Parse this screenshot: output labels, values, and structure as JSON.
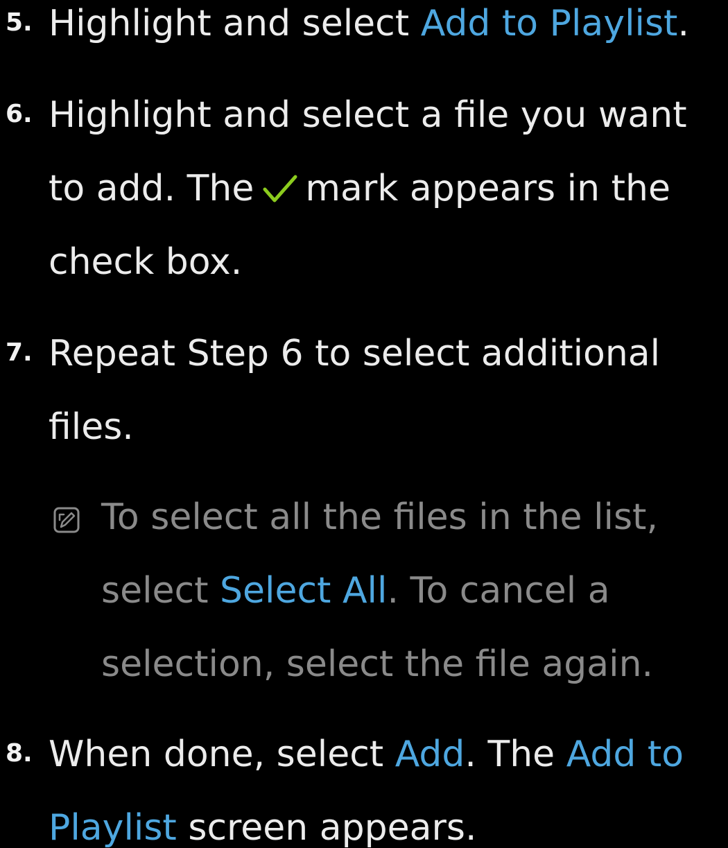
{
  "steps": [
    {
      "number": "5.",
      "line1": {
        "pre": "Highlight and select ",
        "link": "Add to Playlist",
        "post": "."
      }
    },
    {
      "number": "6.",
      "line1": "Highlight and select a file you want",
      "line2": {
        "pre": "to add. The",
        "post": "mark appears in the"
      },
      "line3": "check box."
    },
    {
      "number": "7.",
      "line1": "Repeat Step 6 to select additional",
      "line2": "files.",
      "note": {
        "line1": "To select all the files in the list,",
        "line2": {
          "pre": "select ",
          "link": "Select All",
          "post": ". To cancel a"
        },
        "line3": "selection, select the file again."
      }
    },
    {
      "number": "8.",
      "line1": {
        "pre": "When done, select ",
        "link1": "Add",
        "mid": ". The ",
        "link2": "Add to"
      },
      "line2": {
        "link": "Playlist",
        "post": " screen appears."
      }
    }
  ],
  "icons": {
    "check": "check-mark-icon",
    "note": "note-icon"
  },
  "colors": {
    "background": "#000000",
    "text": "#ececec",
    "highlight": "#4ea7e0",
    "note_text": "#8a8a8a",
    "check": "#8ccc1e"
  }
}
